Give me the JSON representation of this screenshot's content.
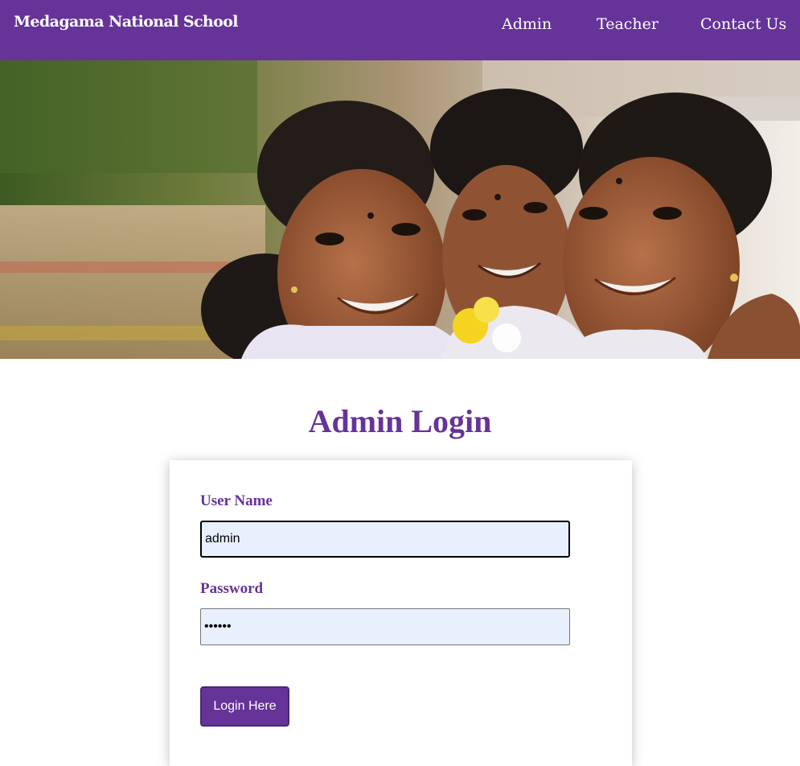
{
  "navbar": {
    "brand": "Medagama National School",
    "links": [
      "Admin",
      "Teacher",
      "Contact Us"
    ],
    "background_color": "#663399"
  },
  "hero": {
    "description": "photo of three smiling schoolgirls"
  },
  "login": {
    "title": "Admin Login",
    "username_label": "User Name",
    "username_value": "admin",
    "password_label": "Password",
    "password_value": "••••••",
    "button_label": "Login Here"
  },
  "colors": {
    "accent": "#663399",
    "input_background": "#e8f0fe"
  }
}
